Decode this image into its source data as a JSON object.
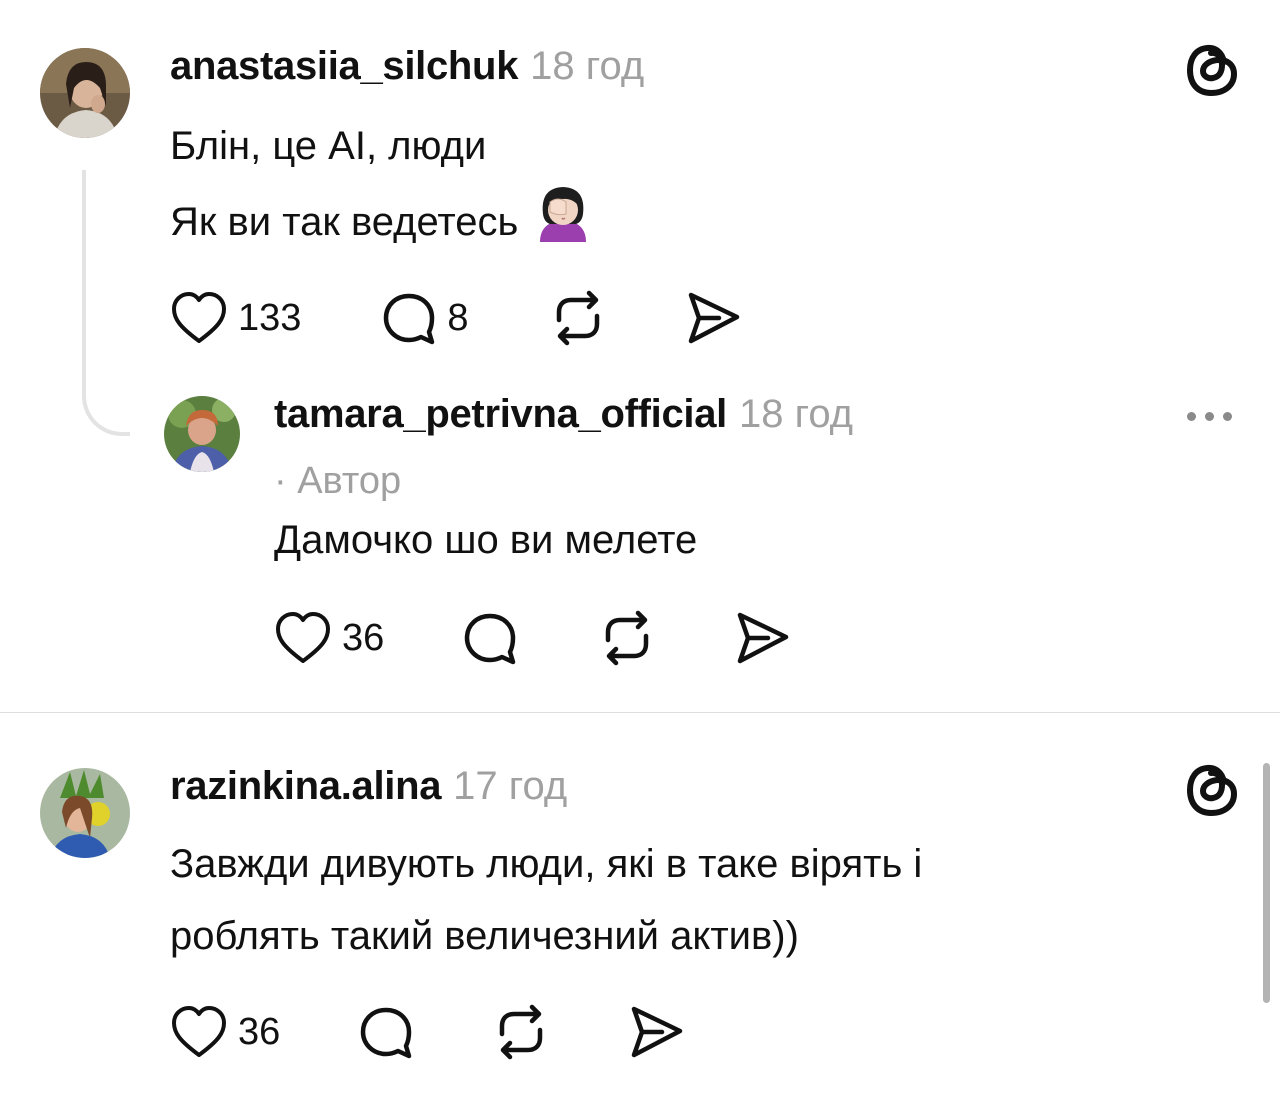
{
  "comments": [
    {
      "username": "anastasiia_silchuk",
      "time": "18 год",
      "lines": [
        "Блін, це AI, люди",
        "Як ви так ведетесь"
      ],
      "emoji": "woman-facepalming-icon",
      "likes": "133",
      "replies": "8"
    },
    {
      "username": "tamara_petrivna_official",
      "time": "18 год",
      "author_tag": "· Автор",
      "lines": [
        "Дамочко шо ви мелете"
      ],
      "likes": "36"
    },
    {
      "username": "razinkina.alina",
      "time": "17 год",
      "lines": [
        "Завжди дивують люди, які в таке вірять і",
        "роблять такий величезний актив))"
      ],
      "likes": "36"
    }
  ],
  "icons": {
    "like": "heart-icon",
    "reply": "comment-bubble-icon",
    "repost": "repost-icon",
    "share": "send-icon",
    "brand": "threads-logo-icon",
    "menu": "more-options-icon"
  },
  "colors": {
    "text": "#111111",
    "muted": "#a0a0a0",
    "divider": "#dedede"
  }
}
